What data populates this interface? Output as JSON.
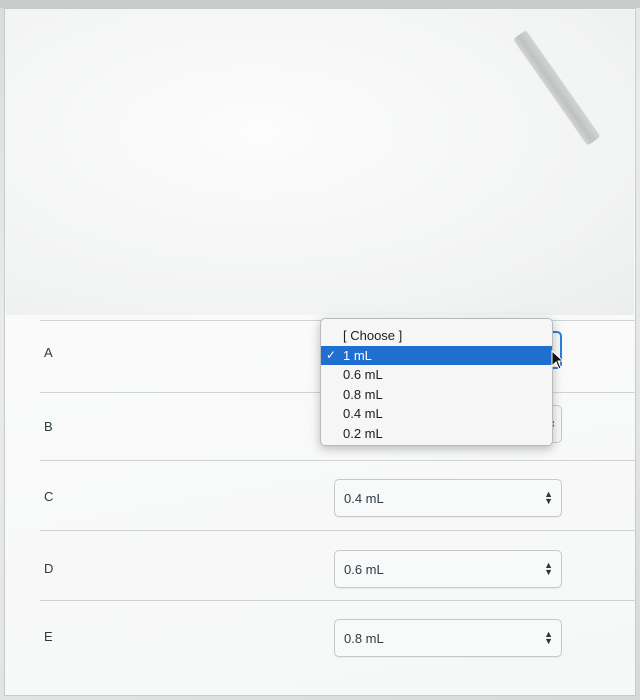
{
  "rows": [
    {
      "label": "A",
      "value": "1 mL",
      "open": true
    },
    {
      "label": "B",
      "value": "",
      "open": false
    },
    {
      "label": "C",
      "value": "0.4 mL",
      "open": false
    },
    {
      "label": "D",
      "value": "0.6 mL",
      "open": false
    },
    {
      "label": "E",
      "value": "0.8 mL",
      "open": false
    }
  ],
  "dropdown": {
    "options": [
      "[ Choose ]",
      "1 mL",
      "0.6 mL",
      "0.8 mL",
      "0.4 mL",
      "0.2 mL"
    ],
    "selected_index": 1,
    "check_glyph": "✓"
  },
  "colors": {
    "selected_highlight": "#1f6fd0",
    "focus_border": "#2a7ce0"
  },
  "icons": {
    "select_arrows": "updown-arrows-icon",
    "checkmark": "checkmark-icon",
    "cursor": "mouse-pointer-icon"
  }
}
